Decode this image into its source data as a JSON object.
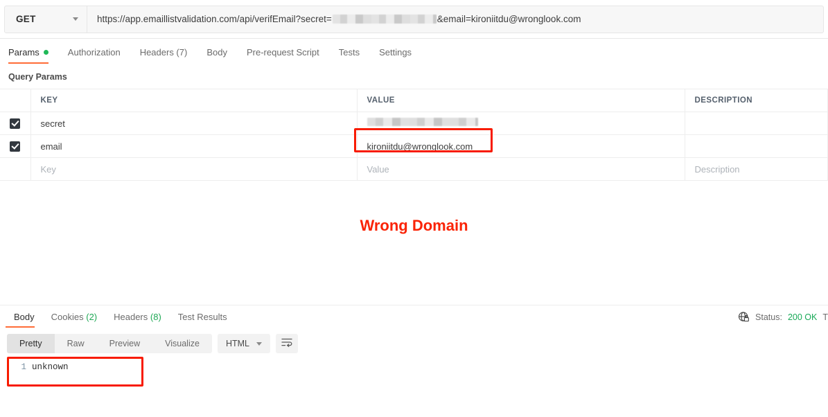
{
  "request": {
    "method": "GET",
    "url_prefix": "https://app.emaillistvalidation.com/api/verifEmail?secret=",
    "url_suffix": "&email=kironiitdu@wronglook.com",
    "url_secret_redacted": true,
    "tabs": [
      {
        "label": "Params",
        "active": true,
        "indicator": "green-dot"
      },
      {
        "label": "Authorization",
        "active": false
      },
      {
        "label": "Headers (7)",
        "active": false
      },
      {
        "label": "Body",
        "active": false
      },
      {
        "label": "Pre-request Script",
        "active": false
      },
      {
        "label": "Tests",
        "active": false
      },
      {
        "label": "Settings",
        "active": false
      }
    ]
  },
  "query_params": {
    "section_title": "Query Params",
    "headers": {
      "key": "KEY",
      "value": "VALUE",
      "description": "DESCRIPTION"
    },
    "rows": [
      {
        "checked": true,
        "key": "secret",
        "value": "",
        "value_redacted": true,
        "description": ""
      },
      {
        "checked": true,
        "key": "email",
        "value": "kironiitdu@wronglook.com",
        "value_redacted": false,
        "description": "",
        "highlighted": true
      },
      {
        "checked": false,
        "key": "Key",
        "value": "Value",
        "description": "Description",
        "placeholder_row": true
      }
    ]
  },
  "annotation": {
    "text": "Wrong Domain",
    "color": "#fa2305"
  },
  "response": {
    "tabs": [
      {
        "label": "Body",
        "count": "",
        "active": true
      },
      {
        "label": "Cookies",
        "count": "(2)",
        "active": false
      },
      {
        "label": "Headers",
        "count": "(8)",
        "active": false
      },
      {
        "label": "Test Results",
        "count": "",
        "active": false
      }
    ],
    "status": {
      "label": "Status:",
      "value": "200 OK",
      "color": "#18a957",
      "trailing_truncated": "T"
    },
    "view_modes": [
      {
        "label": "Pretty",
        "active": true
      },
      {
        "label": "Raw",
        "active": false
      },
      {
        "label": "Preview",
        "active": false
      },
      {
        "label": "Visualize",
        "active": false
      }
    ],
    "format": "HTML",
    "body": {
      "lines": [
        {
          "number": "1",
          "text": "unknown"
        }
      ],
      "highlighted": true
    }
  }
}
